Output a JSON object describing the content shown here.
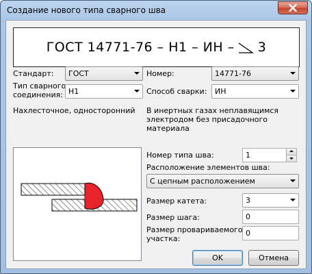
{
  "window": {
    "title": "Создание нового типа сварного шва"
  },
  "symbol": {
    "text": "ГОСТ 14771-76 – Н1 – ИН –",
    "leg_size": "3"
  },
  "standard": {
    "label": "Стандарт:",
    "value": "ГОСТ"
  },
  "number": {
    "label": "Номер:",
    "value": "14771-76"
  },
  "joint_type": {
    "label_line1": "Тип сварного",
    "label_line2": "соединения:",
    "value": "Н1",
    "description": "Нахлесточное, односторонний"
  },
  "welding_method": {
    "label": "Способ сварки:",
    "value": "ИН",
    "description_line1": "В инертных газах неплавящимся",
    "description_line2": "электродом без присадочного материала"
  },
  "seam_type_number": {
    "label": "Номер типа шва:",
    "value": "1"
  },
  "arrangement": {
    "label": "Расположение элементов шва:",
    "value": "С цепным расположением"
  },
  "leg_size": {
    "label": "Размер катета:",
    "value": "3"
  },
  "pitch": {
    "label": "Размер шага:",
    "value": "0"
  },
  "welded_section": {
    "label_line1": "Размер провариваемого",
    "label_line2": "участка:",
    "value": "0"
  },
  "buttons": {
    "ok": "OK",
    "cancel": "Отмена"
  },
  "icons": {
    "close": "close-icon",
    "fillet": "fillet-triangle-icon"
  }
}
